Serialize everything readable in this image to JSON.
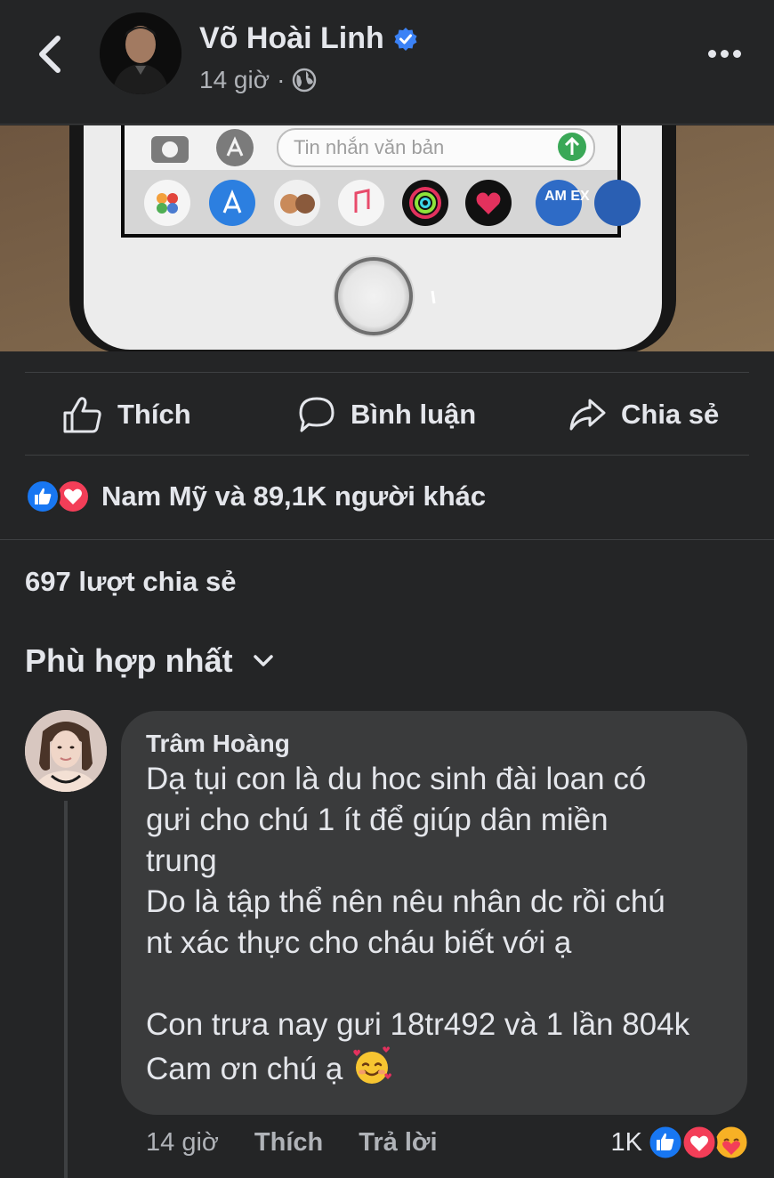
{
  "post": {
    "author_name": "Võ Hoài Linh",
    "time": "14 giờ",
    "separator": "·",
    "photo_text_field": "Tin nhắn văn bản",
    "photo_amex": "AM EX"
  },
  "actions": {
    "like": "Thích",
    "comment": "Bình luận",
    "share": "Chia sẻ"
  },
  "reactions_summary": "Nam Mỹ và 89,1K người khác",
  "shares_count": "697 lượt chia sẻ",
  "sort_label": "Phù hợp nhất",
  "comment": {
    "author": "Trâm Hoàng",
    "lines": [
      "Dạ tụi con là du hoc sinh đài loan có",
      "gưi cho chú 1 ít để giúp dân miền",
      "trung",
      "Do là tập thể nên nêu nhân dc rồi chú",
      "nt xác thực cho cháu biết với ạ",
      "Con trưa nay gưi 18tr492 và 1 lần 804k",
      "Cam ơn chú ạ"
    ],
    "time": "14 giờ",
    "like": "Thích",
    "reply": "Trả lời",
    "reaction_count": "1K"
  },
  "colors": {
    "background": "#242526",
    "bubble": "#3a3b3c",
    "verified_blue": "#3b82f6",
    "like_blue": "#1877f2",
    "love_red": "#f33e58",
    "care_yellow": "#f7b125"
  },
  "icons": [
    "back-chevron-icon",
    "verified-badge-icon",
    "globe-icon",
    "more-dots-icon",
    "like-thumb-icon",
    "comment-bubble-icon",
    "share-arrow-icon",
    "chevron-down-icon",
    "smiling-hearts-emoji"
  ]
}
